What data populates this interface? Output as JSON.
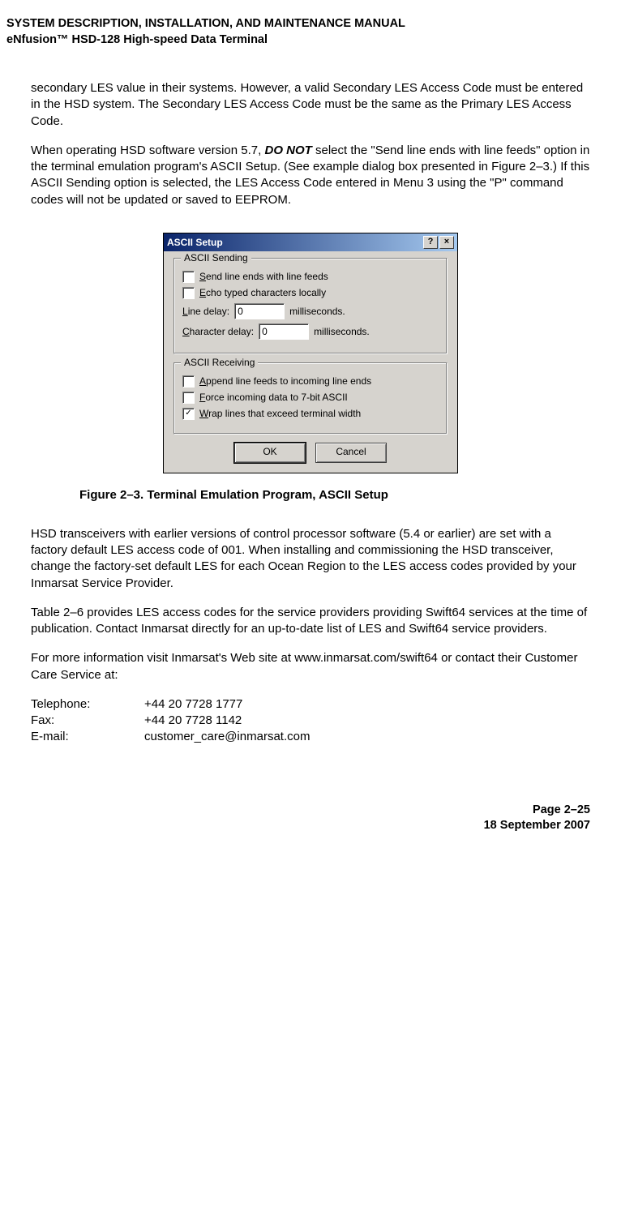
{
  "header": {
    "line1": "SYSTEM DESCRIPTION, INSTALLATION, AND MAINTENANCE MANUAL",
    "line2": "eNfusion™ HSD-128 High-speed Data Terminal"
  },
  "paragraphs": {
    "p1": "secondary LES value in their systems. However, a valid Secondary LES Access Code must be entered in the HSD system. The Secondary LES Access Code must be the same as the Primary LES Access Code.",
    "p2_a": "When operating HSD software version 5.7, ",
    "p2_b": "DO NOT",
    "p2_c": " select the \"Send line ends with line feeds\" option in the terminal emulation program's ASCII Setup. (See example dialog box presented in Figure 2–3.) If this ASCII Sending option is selected, the LES Access Code entered in Menu 3 using the \"P\" command codes will not be updated or saved to EEPROM.",
    "caption": "Figure 2–3. Terminal Emulation Program, ASCII Setup",
    "p3": "HSD transceivers with earlier versions of control processor software (5.4 or earlier) are set with a factory default LES access code of  001. When installing and commissioning the HSD transceiver, change the factory-set default LES for each Ocean Region to the LES access codes provided by your Inmarsat Service Provider.",
    "p4": "Table 2–6 provides LES access codes for the service providers providing Swift64 services at the time of publication. Contact Inmarsat directly for an up-to-date list of LES and Swift64 service providers.",
    "p5": "For more information visit Inmarsat's Web site at www.inmarsat.com/swift64 or contact their Customer Care Service at:"
  },
  "contact": {
    "tel_label": "Telephone:",
    "tel_value": "+44 20 7728 1777",
    "fax_label": "Fax:",
    "fax_value": "+44 20 7728 1142",
    "email_label": "E-mail:",
    "email_value": "customer_care@inmarsat.com"
  },
  "footer": {
    "page": "Page 2–25",
    "date": "18 September 2007"
  },
  "dialog": {
    "title": "ASCII Setup",
    "help_glyph": "?",
    "close_glyph": "×",
    "group_sending": "ASCII Sending",
    "send_line_ends": "Send line ends with line feeds",
    "echo_typed": "Echo typed characters locally",
    "line_delay_label": "Line delay:",
    "line_delay_value": "0",
    "char_delay_label": "Character delay:",
    "char_delay_value": "0",
    "ms": "milliseconds.",
    "group_receiving": "ASCII Receiving",
    "append_lf": "Append line feeds to incoming line ends",
    "force_7bit": "Force incoming data to 7-bit ASCII",
    "wrap_lines": "Wrap lines that exceed terminal width",
    "wrap_checked": "✓",
    "ok": "OK",
    "cancel": "Cancel"
  }
}
